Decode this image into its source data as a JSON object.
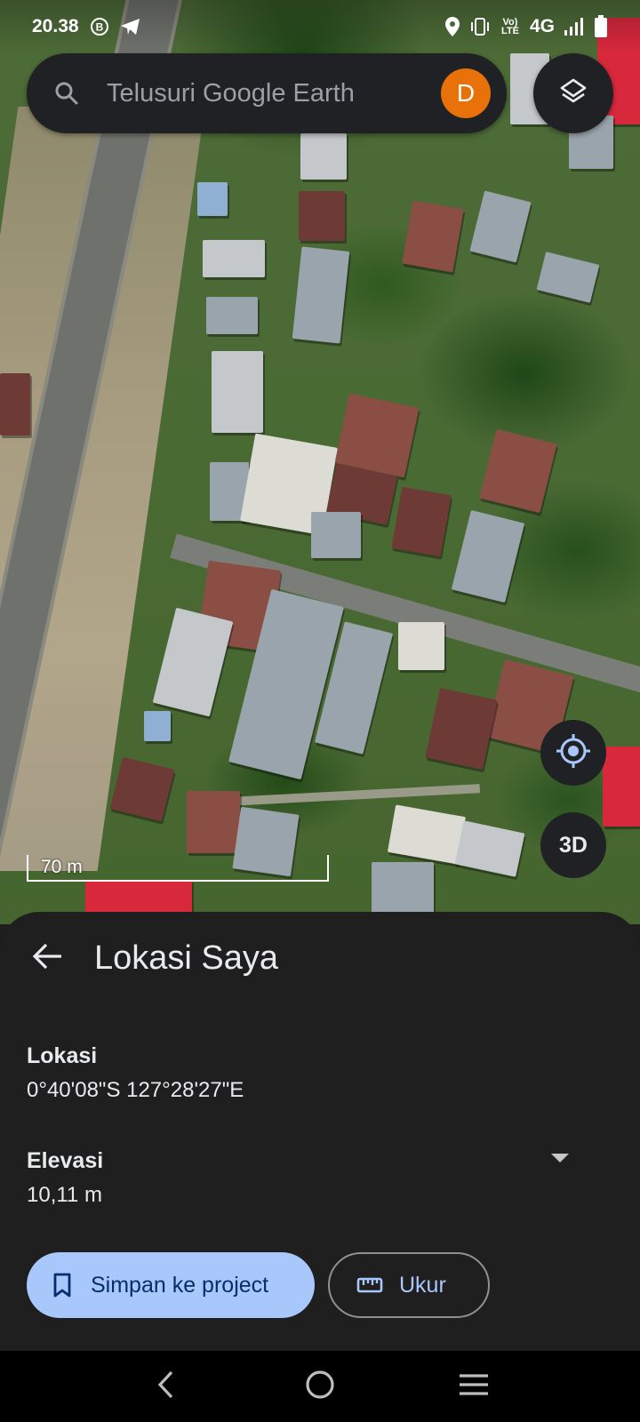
{
  "status_bar": {
    "time": "20.38",
    "network": "4G",
    "volte": "Vo) LTE",
    "icons": [
      "b-circle-icon",
      "telegram-icon",
      "location-pin-icon",
      "vibrate-icon",
      "volte-icon",
      "signal-icon",
      "battery-icon"
    ]
  },
  "search": {
    "placeholder": "Telusuri Google Earth",
    "avatar_initial": "D",
    "avatar_color": "#e8710a"
  },
  "map": {
    "scale_label": "70 m",
    "button_3d": "3D"
  },
  "sheet": {
    "title": "Lokasi Saya",
    "location_label": "Lokasi",
    "location_value": "0°40'08\"S 127°28'27\"E",
    "elevation_label": "Elevasi",
    "elevation_value": "10,11 m",
    "save_label": "Simpan ke project",
    "measure_label": "Ukur"
  },
  "colors": {
    "accent_button": "#a8c7fa",
    "sheet_bg": "#1f1f1f",
    "surface": "#202124"
  }
}
